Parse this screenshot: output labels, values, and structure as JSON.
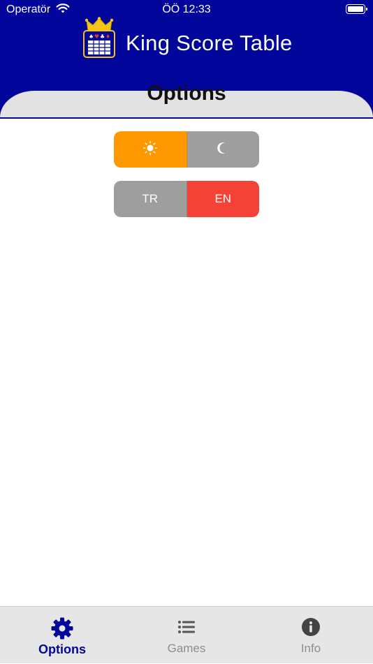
{
  "status_bar": {
    "carrier": "Operatör",
    "time": "ÖÖ 12:33"
  },
  "header": {
    "title": "King Score Table"
  },
  "page": {
    "title": "Options"
  },
  "theme_toggle": {
    "light_icon": "sun-icon",
    "dark_icon": "moon-icon",
    "active_color": "#ff9800",
    "inactive_color": "#9e9e9e",
    "selected": "light"
  },
  "language_toggle": {
    "options": [
      "TR",
      "EN"
    ],
    "selected": "EN",
    "active_color": "#f44336",
    "inactive_color": "#9e9e9e"
  },
  "tab_bar": {
    "tabs": [
      {
        "label": "Options",
        "icon": "gear-icon",
        "active": true
      },
      {
        "label": "Games",
        "icon": "list-icon",
        "active": false
      },
      {
        "label": "Info",
        "icon": "info-icon",
        "active": false
      }
    ],
    "active_color": "#02069a",
    "inactive_color": "#8d8d8d"
  },
  "colors": {
    "brand": "#02069a",
    "panel": "#e2e2e2"
  }
}
